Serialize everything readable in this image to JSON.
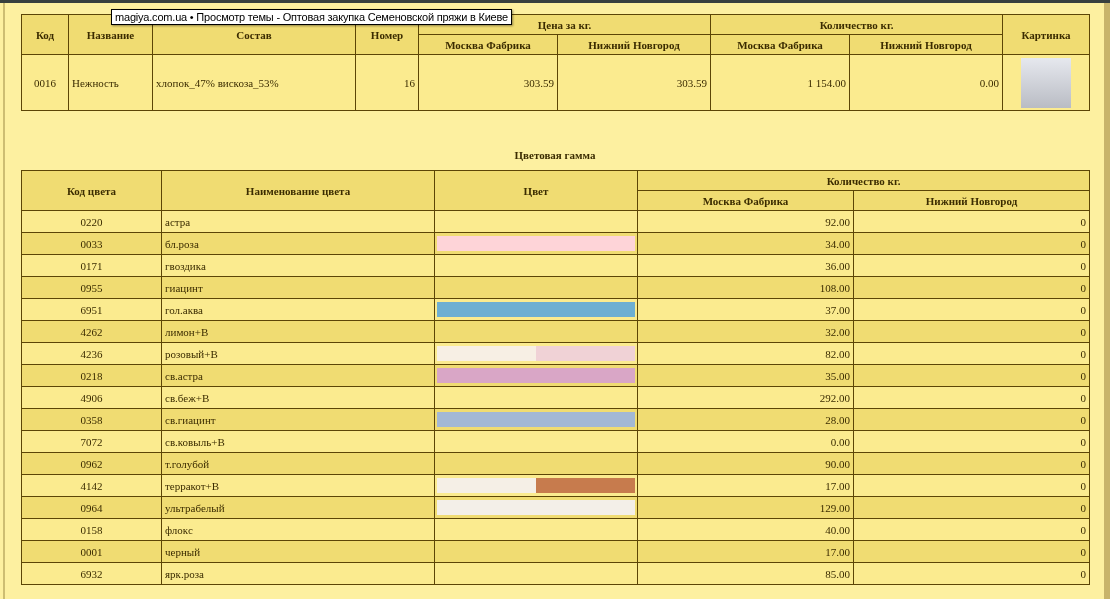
{
  "tooltip": {
    "text": "magiya.com.ua • Просмотр темы - Оптовая закупка Семеновской пряжи в Киеве"
  },
  "product_table": {
    "columns": [
      {
        "label": "Код"
      },
      {
        "label": "Название"
      },
      {
        "label": "Состав"
      },
      {
        "label": "Номер"
      },
      {
        "label": "Цена за кг.",
        "children": [
          {
            "label": "Москва Фабрика"
          },
          {
            "label": "Нижний Новгород"
          }
        ]
      },
      {
        "label": "Количество кг.",
        "children": [
          {
            "label": "Москва Фабрика"
          },
          {
            "label": "Нижний Новгород"
          }
        ]
      },
      {
        "label": "Картинка"
      }
    ],
    "rows": [
      {
        "code": "0016",
        "name": "Нежность",
        "composition": "хлопок_47% вискоза_53%",
        "number": "16",
        "price_moscow": "303.59",
        "price_nn": "303.59",
        "qty_moscow": "1 154.00",
        "qty_nn": "0.00"
      }
    ]
  },
  "color_table": {
    "title": "Цветовая гамма",
    "columns": [
      {
        "label": "Код цвета"
      },
      {
        "label": "Наименование цвета"
      },
      {
        "label": "Цвет"
      },
      {
        "label": "Количество кг.",
        "children": [
          {
            "label": "Москва Фабрика"
          },
          {
            "label": "Нижний Новгород"
          }
        ]
      }
    ],
    "rows": [
      {
        "code": "0220",
        "name": "астра",
        "qty_moscow": "92.00",
        "qty_nn": "0"
      },
      {
        "code": "0033",
        "name": "бл.роза",
        "swatch": [
          {
            "color": "#fed4d8"
          }
        ],
        "qty_moscow": "34.00",
        "qty_nn": "0"
      },
      {
        "code": "0171",
        "name": "гвоздика",
        "qty_moscow": "36.00",
        "qty_nn": "0"
      },
      {
        "code": "0955",
        "name": "гиацинт",
        "qty_moscow": "108.00",
        "qty_nn": "0"
      },
      {
        "code": "6951",
        "name": "гол.аква",
        "swatch": [
          {
            "color": "#6eafd2"
          }
        ],
        "qty_moscow": "37.00",
        "qty_nn": "0"
      },
      {
        "code": "4262",
        "name": "лимон+В",
        "qty_moscow": "32.00",
        "qty_nn": "0"
      },
      {
        "code": "4236",
        "name": "розовый+В",
        "swatch": [
          {
            "color": "#f7efe4"
          },
          {
            "color": "#f0d2d6"
          }
        ],
        "qty_moscow": "82.00",
        "qty_nn": "0"
      },
      {
        "code": "0218",
        "name": "св.астра",
        "swatch": [
          {
            "color": "#d9a6c6"
          }
        ],
        "qty_moscow": "35.00",
        "qty_nn": "0"
      },
      {
        "code": "4906",
        "name": "св.беж+В",
        "qty_moscow": "292.00",
        "qty_nn": "0"
      },
      {
        "code": "0358",
        "name": "св.гиацинт",
        "swatch": [
          {
            "color": "#a3b8d5"
          }
        ],
        "qty_moscow": "28.00",
        "qty_nn": "0"
      },
      {
        "code": "7072",
        "name": "св.ковыль+В",
        "qty_moscow": "0.00",
        "qty_nn": "0"
      },
      {
        "code": "0962",
        "name": "т.голубой",
        "qty_moscow": "90.00",
        "qty_nn": "0"
      },
      {
        "code": "4142",
        "name": "терракот+В",
        "swatch": [
          {
            "color": "#f5efe6"
          },
          {
            "color": "#c77b4d"
          }
        ],
        "qty_moscow": "17.00",
        "qty_nn": "0"
      },
      {
        "code": "0964",
        "name": "ультрабелый",
        "swatch": [
          {
            "color": "#f3efe8"
          }
        ],
        "qty_moscow": "129.00",
        "qty_nn": "0"
      },
      {
        "code": "0158",
        "name": "флокс",
        "qty_moscow": "40.00",
        "qty_nn": "0"
      },
      {
        "code": "0001",
        "name": "черный",
        "qty_moscow": "17.00",
        "qty_nn": "0"
      },
      {
        "code": "6932",
        "name": "ярк.роза",
        "qty_moscow": "85.00",
        "qty_nn": "0"
      }
    ]
  }
}
